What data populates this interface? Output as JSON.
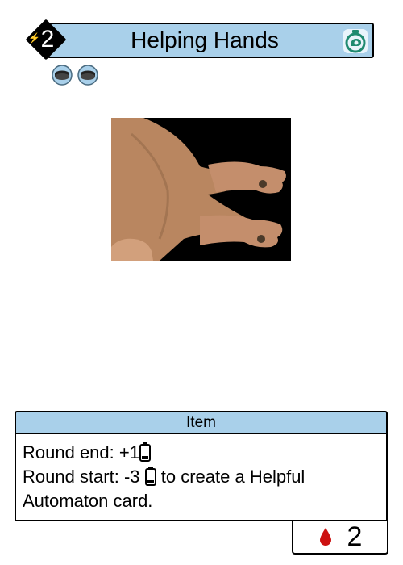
{
  "card": {
    "title": "Helping Hands",
    "energy_cost": "2",
    "type_label": "Item",
    "rules": {
      "line1_prefix": "Round end: +1",
      "line2_prefix": "Round start: -3",
      "line2_suffix": " to create a Helpful Automaton card."
    },
    "blood_cost": "2",
    "token_count": 2,
    "colors": {
      "banner": "#a9d0ea",
      "speed_icon": "#1f8a70",
      "blood": "#cc1111"
    },
    "icons": [
      "energy-bolt-icon",
      "speed-snail-icon",
      "gem-token-icon",
      "battery-icon",
      "blood-drop-icon"
    ]
  }
}
